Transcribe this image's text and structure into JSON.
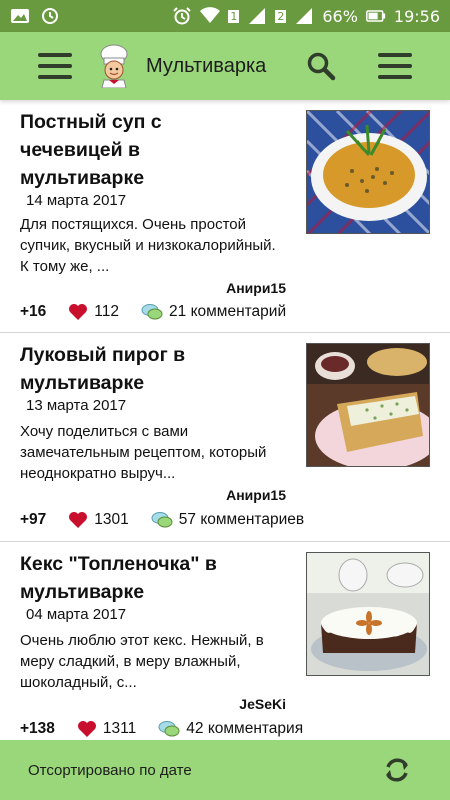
{
  "status_bar": {
    "battery": "66%",
    "time": "19:56",
    "sim1": "1",
    "sim2": "2"
  },
  "app_bar": {
    "title": "Мультиварка"
  },
  "recipes": [
    {
      "title": "Постный суп с чечевицей в мультиварке",
      "date": "14 марта 2017",
      "description": "Для постящихся. Очень простой супчик, вкусный и низкокалорийный. К тому же, ...",
      "author": "Анири15",
      "votes": "+16",
      "likes": "112",
      "comments": "21 комментарий"
    },
    {
      "title": "Луковый пирог в мультиварке",
      "date": "13 марта 2017",
      "description": "Хочу поделиться с вами замечательным рецептом, который неоднократно выруч...",
      "author": "Анири15",
      "votes": "+97",
      "likes": "1301",
      "comments": "57 комментариев"
    },
    {
      "title": "Кекс \"Топленочка\" в мультиварке",
      "date": "04 марта 2017",
      "description": "Очень люблю этот кекс. Нежный, в меру сладкий, в меру влажный, шоколадный, с...",
      "author": "JeSeKi",
      "votes": "+138",
      "likes": "1311",
      "comments": "42 комментария"
    }
  ],
  "bottom_bar": {
    "sort_label": "Отсортировано по дате"
  },
  "colors": {
    "status_bar": "#6a9a3f",
    "app_bar": "#9ad67a",
    "heart": "#c8102e"
  }
}
